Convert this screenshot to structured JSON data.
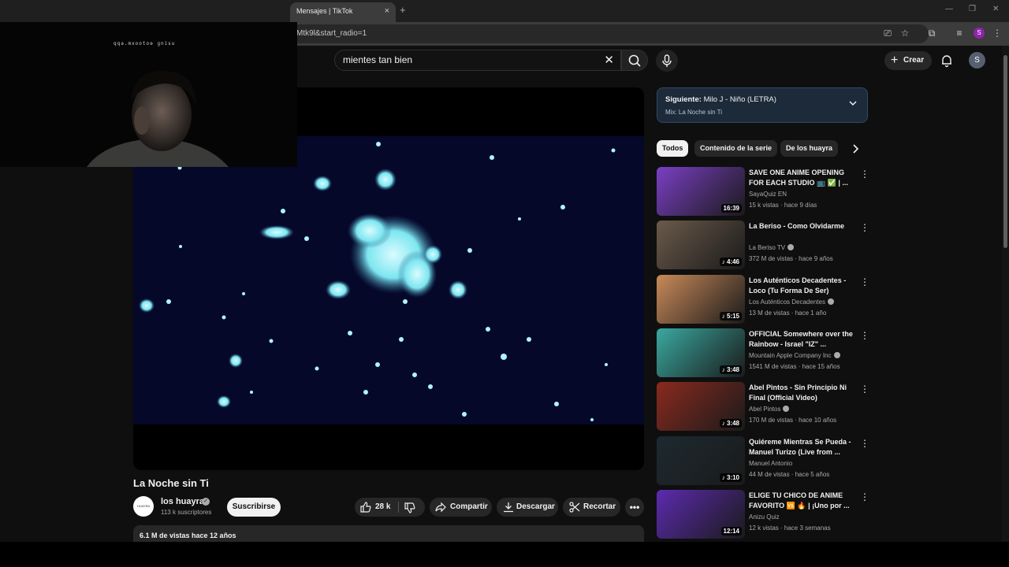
{
  "browser": {
    "tab_title": "Mensajes | TikTok",
    "tab_close": "×",
    "new_tab": "+",
    "url": "Mtk9l&start_radio=1",
    "profile_initial": "S"
  },
  "header": {
    "search_value": "mientes tan bien",
    "create_label": "Crear",
    "avatar_initial": "S"
  },
  "webcam": {
    "mirrored_text": "qqa.mxootoɘ ɡnisu"
  },
  "video": {
    "title": "La Noche sin Ti",
    "channel": "los huayra",
    "channel_avatar_text": "HUAYRA",
    "subscribers": "113 k suscriptores",
    "subscribe_label": "Suscribirse",
    "likes": "28 k",
    "share_label": "Compartir",
    "download_label": "Descargar",
    "clip_label": "Recortar",
    "description_meta": "6.1 M de vistas  hace 12 años"
  },
  "next_up": {
    "prefix": "Siguiente:",
    "title": "Milo J - Niño (LETRA)",
    "mix": "Mix: La Noche sin Ti"
  },
  "chips": [
    "Todos",
    "Contenido de la serie",
    "De los huayra"
  ],
  "recommendations": [
    {
      "title": "SAVE ONE ANIME OPENING FOR EACH STUDIO 📺 ✅ | ...",
      "channel": "SayaQuiz EN",
      "verified": false,
      "meta": "15 k vistas · hace 9 días",
      "duration": "16:39",
      "thumb_color": "#7a3fc4"
    },
    {
      "title": "La Beriso - Como Olvidarme",
      "channel": "La Beriso TV",
      "verified": true,
      "meta": "372 M de vistas · hace 9 años",
      "duration": "♪ 4:46",
      "thumb_color": "#6b5a4a"
    },
    {
      "title": "Los Auténticos Decadentes - Loco (Tu Forma De Ser) (Offici...",
      "channel": "Los Auténticos Decadentes",
      "verified": true,
      "meta": "13 M de vistas · hace 1 año",
      "duration": "♪ 5:15",
      "thumb_color": "#c98a5a"
    },
    {
      "title": "OFFICIAL Somewhere over the Rainbow - Israel \"IZ\" ...",
      "channel": "Mountain Apple Company Inc",
      "verified": true,
      "meta": "1541 M de vistas · hace 15 años",
      "duration": "♪ 3:48",
      "thumb_color": "#3aa9a0"
    },
    {
      "title": "Abel Pintos - Sin Principio Ni Final (Official Video)",
      "channel": "Abel Pintos",
      "verified": true,
      "meta": "170 M de vistas · hace 10 años",
      "duration": "♪ 3:48",
      "thumb_color": "#8a2a1e"
    },
    {
      "title": "Quiéreme Mientras Se Pueda - Manuel Turizo (Live from ...",
      "channel": "Manuel Antonio",
      "verified": false,
      "meta": "44 M de vistas · hace 5 años",
      "duration": "♪ 3:10",
      "thumb_color": "#1d2a30"
    },
    {
      "title": "ELIGE TU CHICO DE ANIME FAVORITO 🆚 🔥 | ¡Uno por ...",
      "channel": "Anizu Quiz",
      "verified": false,
      "meta": "12 k vistas · hace 3 semanas",
      "duration": "12:14",
      "thumb_color": "#5c2bb0"
    }
  ]
}
